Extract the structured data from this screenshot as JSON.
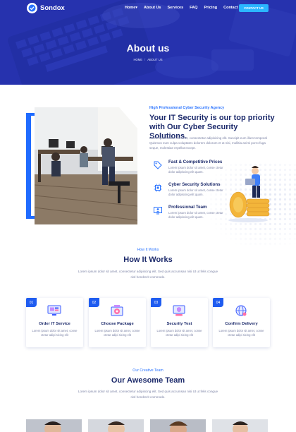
{
  "brand": {
    "name": "Sondox"
  },
  "nav": {
    "items": [
      "Home",
      "About Us",
      "Services",
      "FAQ",
      "Pricing",
      "Contact"
    ],
    "home_chevron": "▾",
    "contact_button": "CONTACT US"
  },
  "hero": {
    "title": "About us",
    "breadcrumb": [
      "HOME",
      "ABOUT US"
    ],
    "breadcrumb_separator": "/"
  },
  "about": {
    "kicker": "High Professional Cyber Security Agency",
    "heading": "Your IT Security is our top priority with Our Cyber Security Solutions.",
    "text": "Lorem ipsum dolor sit amet, consectetur adipisicing elit. Suscipit eum illum temporal Quismos eum culpa voluptates dolorem dolorum et ut nisi, mollitia animi porro fuga seque, molestiae repellat except.",
    "features": [
      {
        "icon": "tag-icon",
        "title": "Fast & Competitive Prices",
        "desc": "Lorem ipsum dolor sit amet, conse ctetur dolor adipiscing elit quam."
      },
      {
        "icon": "cpu-icon",
        "title": "Cyber Security Solutions",
        "desc": "Lorem ipsum dolor sit amet, conse ctetur dolor adipiscing elit quam."
      },
      {
        "icon": "team-icon",
        "title": "Professional Team",
        "desc": "Lorem ipsum dolor sit amet, conse ctetur dolor adipiscing elit quam."
      }
    ]
  },
  "how": {
    "kicker": "How It Works",
    "title": "How It Works",
    "text": "Lorem ipsum dolor sit amet, consectetur adipiscing elit. Sed quis accumsan nisi Ut ut felis congue nisl hendrerit commodo.",
    "cards": [
      {
        "num": "01",
        "icon": "monitor-icon",
        "title": "Order IT Service",
        "desc": "Lorem ipsum dolor sit amet, conse ctetur adipi sicing elit"
      },
      {
        "num": "02",
        "icon": "package-icon",
        "title": "Choose Package",
        "desc": "Lorem ipsum dolor sit amet, conse ctetur adipi sicing elit"
      },
      {
        "num": "03",
        "icon": "security-test-icon",
        "title": "Security Test",
        "desc": "Lorem ipsum dolor sit amet, conse ctetur adipi sicing elit"
      },
      {
        "num": "04",
        "icon": "globe-icon",
        "title": "Confirm Delivery",
        "desc": "Lorem ipsum dolor sit amet, conse ctetur adipi sicing elit"
      }
    ]
  },
  "team": {
    "kicker": "Our Creative Team",
    "title": "Our Awesome Team",
    "text": "Lorem ipsum dolor sit amet, consectetur adipiscing elit. Sed quis accumsan nisi Ut ut felis congue nisl hendrerit commodo."
  },
  "colors": {
    "primary": "#1f5cf0",
    "accent": "#2bb6ff",
    "heading": "#1c2a6b",
    "text": "#7d84a6",
    "hero": "#2432a8"
  }
}
